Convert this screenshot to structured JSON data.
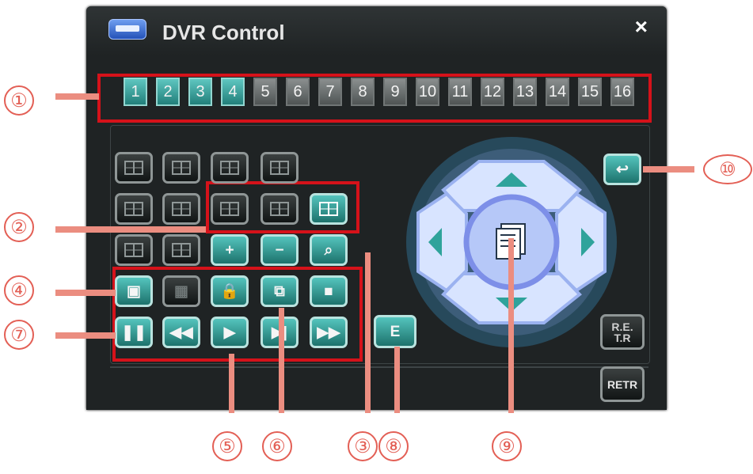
{
  "window": {
    "title": "DVR Control",
    "close_label": "×"
  },
  "channels": [
    {
      "label": "1",
      "active": true
    },
    {
      "label": "2",
      "active": true
    },
    {
      "label": "3",
      "active": true
    },
    {
      "label": "4",
      "active": true
    },
    {
      "label": "5",
      "active": false
    },
    {
      "label": "6",
      "active": false
    },
    {
      "label": "7",
      "active": false
    },
    {
      "label": "8",
      "active": false
    },
    {
      "label": "9",
      "active": false
    },
    {
      "label": "10",
      "active": false
    },
    {
      "label": "11",
      "active": false
    },
    {
      "label": "12",
      "active": false
    },
    {
      "label": "13",
      "active": false
    },
    {
      "label": "14",
      "active": false
    },
    {
      "label": "15",
      "active": false
    },
    {
      "label": "16",
      "active": false
    }
  ],
  "buttons": {
    "zoom_in": "+",
    "zoom_out": "−",
    "enter": "E",
    "rew": "◀◀",
    "pause": "❚❚",
    "play": "▶",
    "step": "▶|",
    "ffwd": "▶▶",
    "return": "↩",
    "ret_label": "R.E.\nT.R",
    "retr_label": "RETR"
  },
  "callouts": {
    "n1": "①",
    "n2": "②",
    "n3": "③",
    "n4": "④",
    "n5": "⑤",
    "n6": "⑥",
    "n7": "⑦",
    "n8": "⑧",
    "n9": "⑨",
    "n10": "⑩"
  },
  "colors": {
    "accent_teal": "#2fa39b",
    "highlight_red": "#d5121a",
    "callout": "#e35f55"
  }
}
